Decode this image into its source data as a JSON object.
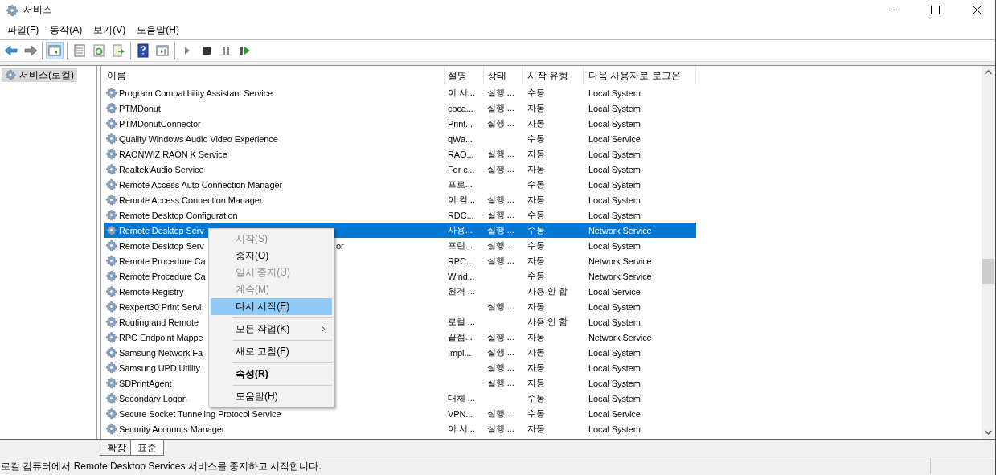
{
  "window": {
    "title": "서비스"
  },
  "menu_bar": [
    "파일(F)",
    "동작(A)",
    "보기(V)",
    "도움말(H)"
  ],
  "toolbar": [
    {
      "kind": "back"
    },
    {
      "kind": "forward"
    },
    {
      "kind": "sep"
    },
    {
      "kind": "tree",
      "selected": true
    },
    {
      "kind": "sep"
    },
    {
      "kind": "sheet"
    },
    {
      "kind": "refresh"
    },
    {
      "kind": "export"
    },
    {
      "kind": "sep"
    },
    {
      "kind": "help"
    },
    {
      "kind": "pane"
    },
    {
      "kind": "sep"
    },
    {
      "kind": "play"
    },
    {
      "kind": "stop"
    },
    {
      "kind": "pause"
    },
    {
      "kind": "resume"
    }
  ],
  "tree": [
    {
      "label": "서비스(로컬)",
      "selected": true
    }
  ],
  "table": {
    "columns": [
      "이름",
      "설명",
      "상태",
      "시작 유형",
      "다음 사용자로 로그온"
    ],
    "rows": [
      {
        "name": "Program Compatibility Assistant Service",
        "desc": "이 서...",
        "status": "실행 ...",
        "startup": "수동",
        "logon": "Local System",
        "selected": false
      },
      {
        "name": "PTMDonut",
        "desc": "coca...",
        "status": "실행 ...",
        "startup": "자동",
        "logon": "Local System",
        "selected": false
      },
      {
        "name": "PTMDonutConnector",
        "desc": "Print...",
        "status": "실행 ...",
        "startup": "자동",
        "logon": "Local System",
        "selected": false
      },
      {
        "name": "Quality Windows Audio Video Experience",
        "desc": "qWa...",
        "status": "",
        "startup": "수동",
        "logon": "Local Service",
        "selected": false
      },
      {
        "name": "RAONWIZ RAON K Service",
        "desc": "RAO...",
        "status": "실행 ...",
        "startup": "자동",
        "logon": "Local System",
        "selected": false
      },
      {
        "name": "Realtek Audio Service",
        "desc": "For c...",
        "status": "실행 ...",
        "startup": "자동",
        "logon": "Local System",
        "selected": false
      },
      {
        "name": "Remote Access Auto Connection Manager",
        "desc": "프로...",
        "status": "",
        "startup": "수동",
        "logon": "Local System",
        "selected": false
      },
      {
        "name": "Remote Access Connection Manager",
        "desc": "이 컴...",
        "status": "실행 ...",
        "startup": "자동",
        "logon": "Local System",
        "selected": false
      },
      {
        "name": "Remote Desktop Configuration",
        "desc": "RDC...",
        "status": "실행 ...",
        "startup": "수동",
        "logon": "Local System",
        "selected": false
      },
      {
        "name": "Remote Desktop Serv",
        "desc": "사용...",
        "status": "실행 ...",
        "startup": "수동",
        "logon": "Network Service",
        "selected": true
      },
      {
        "name": "Remote Desktop Serv",
        "name_tail": "or",
        "desc": "프린...",
        "status": "실행 ...",
        "startup": "수동",
        "logon": "Local System",
        "selected": false
      },
      {
        "name": "Remote Procedure Ca",
        "desc": "RPC...",
        "status": "실행 ...",
        "startup": "자동",
        "logon": "Network Service",
        "selected": false
      },
      {
        "name": "Remote Procedure Ca",
        "desc": "Wind...",
        "status": "",
        "startup": "수동",
        "logon": "Network Service",
        "selected": false
      },
      {
        "name": "Remote Registry",
        "desc": "원격 ...",
        "status": "",
        "startup": "사용 안 함",
        "logon": "Local Service",
        "selected": false
      },
      {
        "name": "Rexpert30 Print Servi",
        "desc": "",
        "status": "실행 ...",
        "startup": "자동",
        "logon": "Local System",
        "selected": false
      },
      {
        "name": "Routing and Remote",
        "desc": "로컬 ...",
        "status": "",
        "startup": "사용 안 함",
        "logon": "Local System",
        "selected": false
      },
      {
        "name": "RPC Endpoint Mappe",
        "desc": "끝점...",
        "status": "실행 ...",
        "startup": "자동",
        "logon": "Network Service",
        "selected": false
      },
      {
        "name": "Samsung Network Fa",
        "desc": "Impl...",
        "status": "실행 ...",
        "startup": "자동",
        "logon": "Local System",
        "selected": false
      },
      {
        "name": "Samsung UPD Utility",
        "desc": "",
        "status": "실행 ...",
        "startup": "자동",
        "logon": "Local System",
        "selected": false
      },
      {
        "name": "SDPrintAgent",
        "desc": "",
        "status": "실행 ...",
        "startup": "자동",
        "logon": "Local System",
        "selected": false
      },
      {
        "name": "Secondary Logon",
        "desc": "대체 ...",
        "status": "",
        "startup": "수동",
        "logon": "Local System",
        "selected": false
      },
      {
        "name": "Secure Socket Tunneling Protocol Service",
        "desc": "VPN...",
        "status": "실행 ...",
        "startup": "수동",
        "logon": "Local Service",
        "selected": false
      },
      {
        "name": "Security Accounts Manager",
        "desc": "이 서...",
        "status": "실행 ...",
        "startup": "자동",
        "logon": "Local System",
        "selected": false
      }
    ]
  },
  "context_menu": [
    {
      "kind": "item",
      "label": "시작(S)",
      "disabled": true,
      "selected": false,
      "bold": false
    },
    {
      "kind": "item",
      "label": "중지(O)",
      "disabled": false,
      "selected": false,
      "bold": false
    },
    {
      "kind": "item",
      "label": "일시 중지(U)",
      "disabled": true,
      "selected": false,
      "bold": false
    },
    {
      "kind": "item",
      "label": "계속(M)",
      "disabled": true,
      "selected": false,
      "bold": false
    },
    {
      "kind": "item",
      "label": "다시 시작(E)",
      "disabled": false,
      "selected": true,
      "bold": false
    },
    {
      "kind": "sep"
    },
    {
      "kind": "submenu",
      "label": "모든 작업(K)",
      "disabled": false,
      "selected": false,
      "bold": false
    },
    {
      "kind": "sep"
    },
    {
      "kind": "item",
      "label": "새로 고침(F)",
      "disabled": false,
      "selected": false,
      "bold": false
    },
    {
      "kind": "sep"
    },
    {
      "kind": "item",
      "label": "속성(R)",
      "disabled": false,
      "selected": false,
      "bold": true
    },
    {
      "kind": "sep"
    },
    {
      "kind": "item",
      "label": "도움말(H)",
      "disabled": false,
      "selected": false,
      "bold": false
    }
  ],
  "view_tabs": [
    {
      "label": "확장",
      "selected": false
    },
    {
      "label": "표준",
      "selected": true
    }
  ],
  "status_bar": "로컬 컴퓨터에서 Remote Desktop Services 서비스를 중지하고 시작합니다."
}
